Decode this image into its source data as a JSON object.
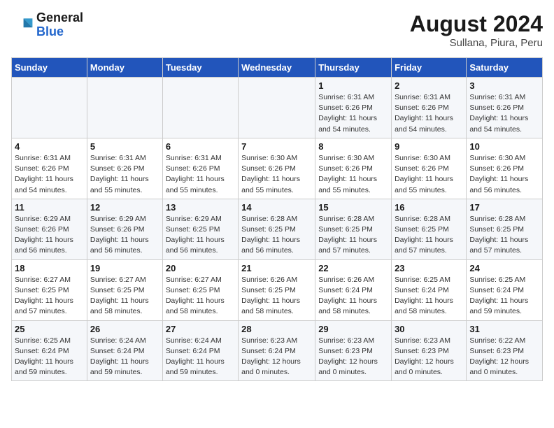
{
  "header": {
    "logo_line1": "General",
    "logo_line2": "Blue",
    "main_title": "August 2024",
    "subtitle": "Sullana, Piura, Peru"
  },
  "columns": [
    "Sunday",
    "Monday",
    "Tuesday",
    "Wednesday",
    "Thursday",
    "Friday",
    "Saturday"
  ],
  "weeks": [
    [
      {
        "day": "",
        "info": ""
      },
      {
        "day": "",
        "info": ""
      },
      {
        "day": "",
        "info": ""
      },
      {
        "day": "",
        "info": ""
      },
      {
        "day": "1",
        "info": "Sunrise: 6:31 AM\nSunset: 6:26 PM\nDaylight: 11 hours and 54 minutes."
      },
      {
        "day": "2",
        "info": "Sunrise: 6:31 AM\nSunset: 6:26 PM\nDaylight: 11 hours and 54 minutes."
      },
      {
        "day": "3",
        "info": "Sunrise: 6:31 AM\nSunset: 6:26 PM\nDaylight: 11 hours and 54 minutes."
      }
    ],
    [
      {
        "day": "4",
        "info": "Sunrise: 6:31 AM\nSunset: 6:26 PM\nDaylight: 11 hours and 54 minutes."
      },
      {
        "day": "5",
        "info": "Sunrise: 6:31 AM\nSunset: 6:26 PM\nDaylight: 11 hours and 55 minutes."
      },
      {
        "day": "6",
        "info": "Sunrise: 6:31 AM\nSunset: 6:26 PM\nDaylight: 11 hours and 55 minutes."
      },
      {
        "day": "7",
        "info": "Sunrise: 6:30 AM\nSunset: 6:26 PM\nDaylight: 11 hours and 55 minutes."
      },
      {
        "day": "8",
        "info": "Sunrise: 6:30 AM\nSunset: 6:26 PM\nDaylight: 11 hours and 55 minutes."
      },
      {
        "day": "9",
        "info": "Sunrise: 6:30 AM\nSunset: 6:26 PM\nDaylight: 11 hours and 55 minutes."
      },
      {
        "day": "10",
        "info": "Sunrise: 6:30 AM\nSunset: 6:26 PM\nDaylight: 11 hours and 56 minutes."
      }
    ],
    [
      {
        "day": "11",
        "info": "Sunrise: 6:29 AM\nSunset: 6:26 PM\nDaylight: 11 hours and 56 minutes."
      },
      {
        "day": "12",
        "info": "Sunrise: 6:29 AM\nSunset: 6:26 PM\nDaylight: 11 hours and 56 minutes."
      },
      {
        "day": "13",
        "info": "Sunrise: 6:29 AM\nSunset: 6:25 PM\nDaylight: 11 hours and 56 minutes."
      },
      {
        "day": "14",
        "info": "Sunrise: 6:28 AM\nSunset: 6:25 PM\nDaylight: 11 hours and 56 minutes."
      },
      {
        "day": "15",
        "info": "Sunrise: 6:28 AM\nSunset: 6:25 PM\nDaylight: 11 hours and 57 minutes."
      },
      {
        "day": "16",
        "info": "Sunrise: 6:28 AM\nSunset: 6:25 PM\nDaylight: 11 hours and 57 minutes."
      },
      {
        "day": "17",
        "info": "Sunrise: 6:28 AM\nSunset: 6:25 PM\nDaylight: 11 hours and 57 minutes."
      }
    ],
    [
      {
        "day": "18",
        "info": "Sunrise: 6:27 AM\nSunset: 6:25 PM\nDaylight: 11 hours and 57 minutes."
      },
      {
        "day": "19",
        "info": "Sunrise: 6:27 AM\nSunset: 6:25 PM\nDaylight: 11 hours and 58 minutes."
      },
      {
        "day": "20",
        "info": "Sunrise: 6:27 AM\nSunset: 6:25 PM\nDaylight: 11 hours and 58 minutes."
      },
      {
        "day": "21",
        "info": "Sunrise: 6:26 AM\nSunset: 6:25 PM\nDaylight: 11 hours and 58 minutes."
      },
      {
        "day": "22",
        "info": "Sunrise: 6:26 AM\nSunset: 6:24 PM\nDaylight: 11 hours and 58 minutes."
      },
      {
        "day": "23",
        "info": "Sunrise: 6:25 AM\nSunset: 6:24 PM\nDaylight: 11 hours and 58 minutes."
      },
      {
        "day": "24",
        "info": "Sunrise: 6:25 AM\nSunset: 6:24 PM\nDaylight: 11 hours and 59 minutes."
      }
    ],
    [
      {
        "day": "25",
        "info": "Sunrise: 6:25 AM\nSunset: 6:24 PM\nDaylight: 11 hours and 59 minutes."
      },
      {
        "day": "26",
        "info": "Sunrise: 6:24 AM\nSunset: 6:24 PM\nDaylight: 11 hours and 59 minutes."
      },
      {
        "day": "27",
        "info": "Sunrise: 6:24 AM\nSunset: 6:24 PM\nDaylight: 11 hours and 59 minutes."
      },
      {
        "day": "28",
        "info": "Sunrise: 6:23 AM\nSunset: 6:24 PM\nDaylight: 12 hours and 0 minutes."
      },
      {
        "day": "29",
        "info": "Sunrise: 6:23 AM\nSunset: 6:23 PM\nDaylight: 12 hours and 0 minutes."
      },
      {
        "day": "30",
        "info": "Sunrise: 6:23 AM\nSunset: 6:23 PM\nDaylight: 12 hours and 0 minutes."
      },
      {
        "day": "31",
        "info": "Sunrise: 6:22 AM\nSunset: 6:23 PM\nDaylight: 12 hours and 0 minutes."
      }
    ]
  ]
}
